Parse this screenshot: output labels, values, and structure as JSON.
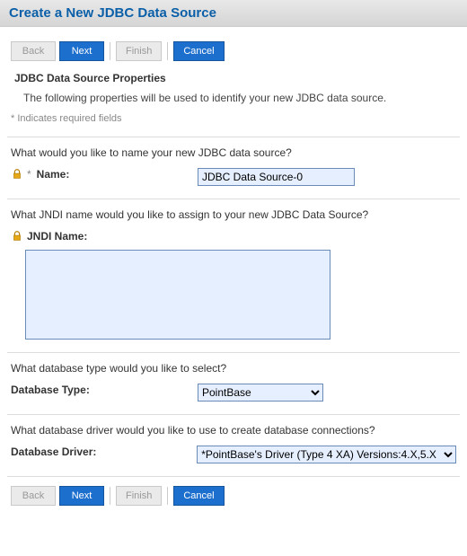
{
  "header": {
    "title": "Create a New JDBC Data Source"
  },
  "buttons": {
    "back": "Back",
    "next": "Next",
    "finish": "Finish",
    "cancel": "Cancel"
  },
  "section_heading": "JDBC Data Source Properties",
  "description": "The following properties will be used to identify your new JDBC data source.",
  "required_note": "* Indicates required fields",
  "fields": {
    "name": {
      "question": "What would you like to name your new JDBC data source?",
      "label": "Name:",
      "value": "JDBC Data Source-0"
    },
    "jndi": {
      "question": "What JNDI name would you like to assign to your new JDBC Data Source?",
      "label": "JNDI Name:",
      "value": ""
    },
    "dbtype": {
      "question": "What database type would you like to select?",
      "label": "Database Type:",
      "value": "PointBase"
    },
    "driver": {
      "question": "What database driver would you like to use to create database connections?",
      "label": "Database Driver:",
      "value": "*PointBase's Driver (Type 4 XA) Versions:4.X,5.X"
    }
  }
}
